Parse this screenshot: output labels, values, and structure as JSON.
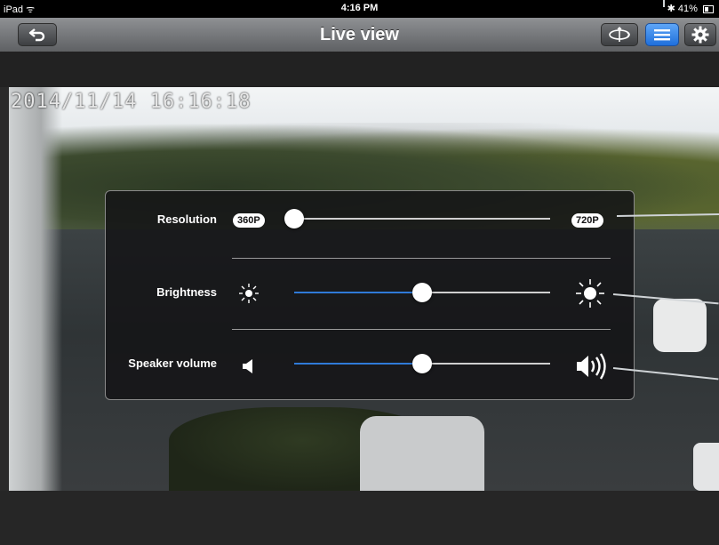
{
  "status_bar": {
    "device": "iPad",
    "time": "4:16 PM",
    "battery": "41%"
  },
  "nav": {
    "title": "Live view",
    "back_icon": "back-arrow-icon",
    "ptz_icon": "ptz-rotate-icon",
    "menu_icon": "menu-list-icon",
    "settings_icon": "gear-icon"
  },
  "video": {
    "timestamp": "2014/11/14 16:16:18"
  },
  "settings_panel": {
    "resolution": {
      "label": "Resolution",
      "min_label": "360P",
      "max_label": "720P",
      "value_fraction": 0.0
    },
    "brightness": {
      "label": "Brightness",
      "min_icon": "brightness-low-icon",
      "max_icon": "brightness-high-icon",
      "value_fraction": 0.5
    },
    "speaker_volume": {
      "label": "Speaker volume",
      "min_icon": "speaker-low-icon",
      "max_icon": "speaker-high-icon",
      "value_fraction": 0.5
    }
  },
  "colors": {
    "accent": "#2f7ad8",
    "panel_bg": "#141416"
  }
}
